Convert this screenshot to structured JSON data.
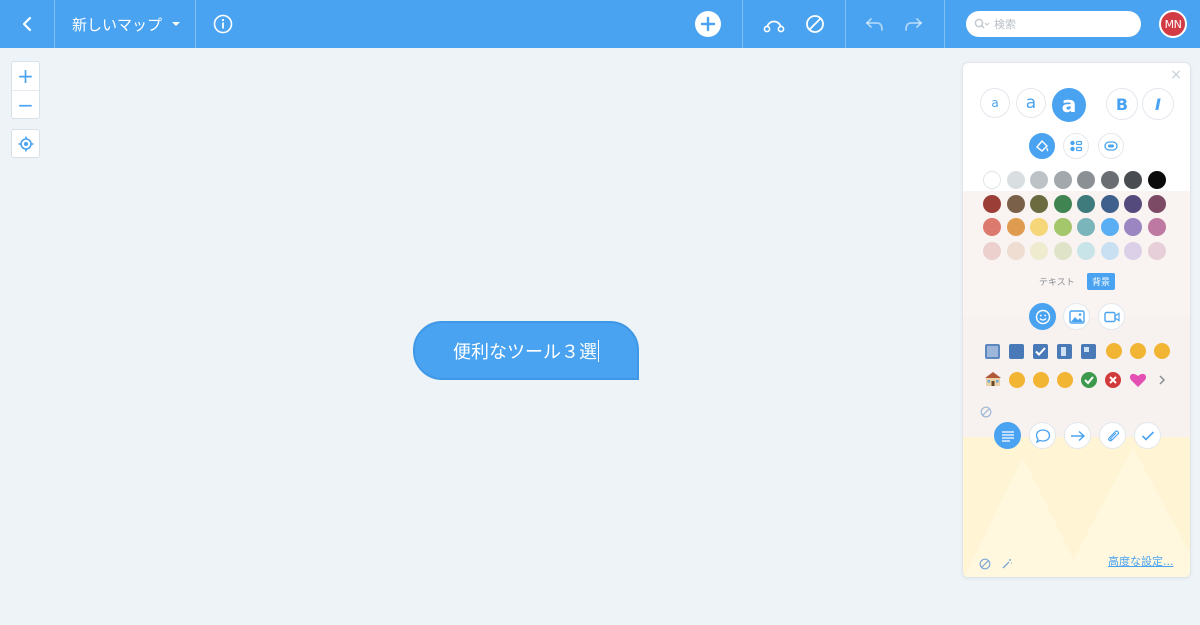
{
  "topbar": {
    "map_title": "新しいマップ",
    "search_placeholder": "検索",
    "avatar_initials": "MN",
    "icons": [
      "back-icon",
      "info-icon",
      "add-icon",
      "link-icon",
      "no-icon",
      "undo-icon",
      "redo-icon",
      "search-icon"
    ]
  },
  "zoom": {
    "in_label": "+",
    "out_label": "−"
  },
  "node": {
    "text": "便利なツール３選"
  },
  "panel": {
    "close_label": "×",
    "text_sizes": [
      "a",
      "a",
      "a"
    ],
    "bold_label": "B",
    "italic_label": "I",
    "tab_text": "テキスト",
    "tab_background": "背景",
    "advanced_label": "高度な設定...",
    "swatch_colors": [
      [
        "#ffffff",
        "#d9dfe0",
        "#bcc2c6",
        "#a3a8ac",
        "#8b9095",
        "#6a6e72",
        "#494d51",
        "#0a0a0a"
      ],
      [
        "#9c3e38",
        "#7a6048",
        "#6b6b3f",
        "#3f8451",
        "#3f7a7d",
        "#3f5f8c",
        "#554a7c",
        "#7d4a66"
      ],
      [
        "#dd7a70",
        "#df9b50",
        "#f5d77a",
        "#a5c76c",
        "#79b5ba",
        "#5aaef3",
        "#9b86c2",
        "#bd79a1"
      ],
      [
        "#ecd0cd",
        "#eeddd0",
        "#eeebcf",
        "#dfe4c8",
        "#c9e4e8",
        "#c9e0f3",
        "#dcd0e8",
        "#e6cfd9"
      ]
    ],
    "accent_color": "#4aa3f0"
  }
}
